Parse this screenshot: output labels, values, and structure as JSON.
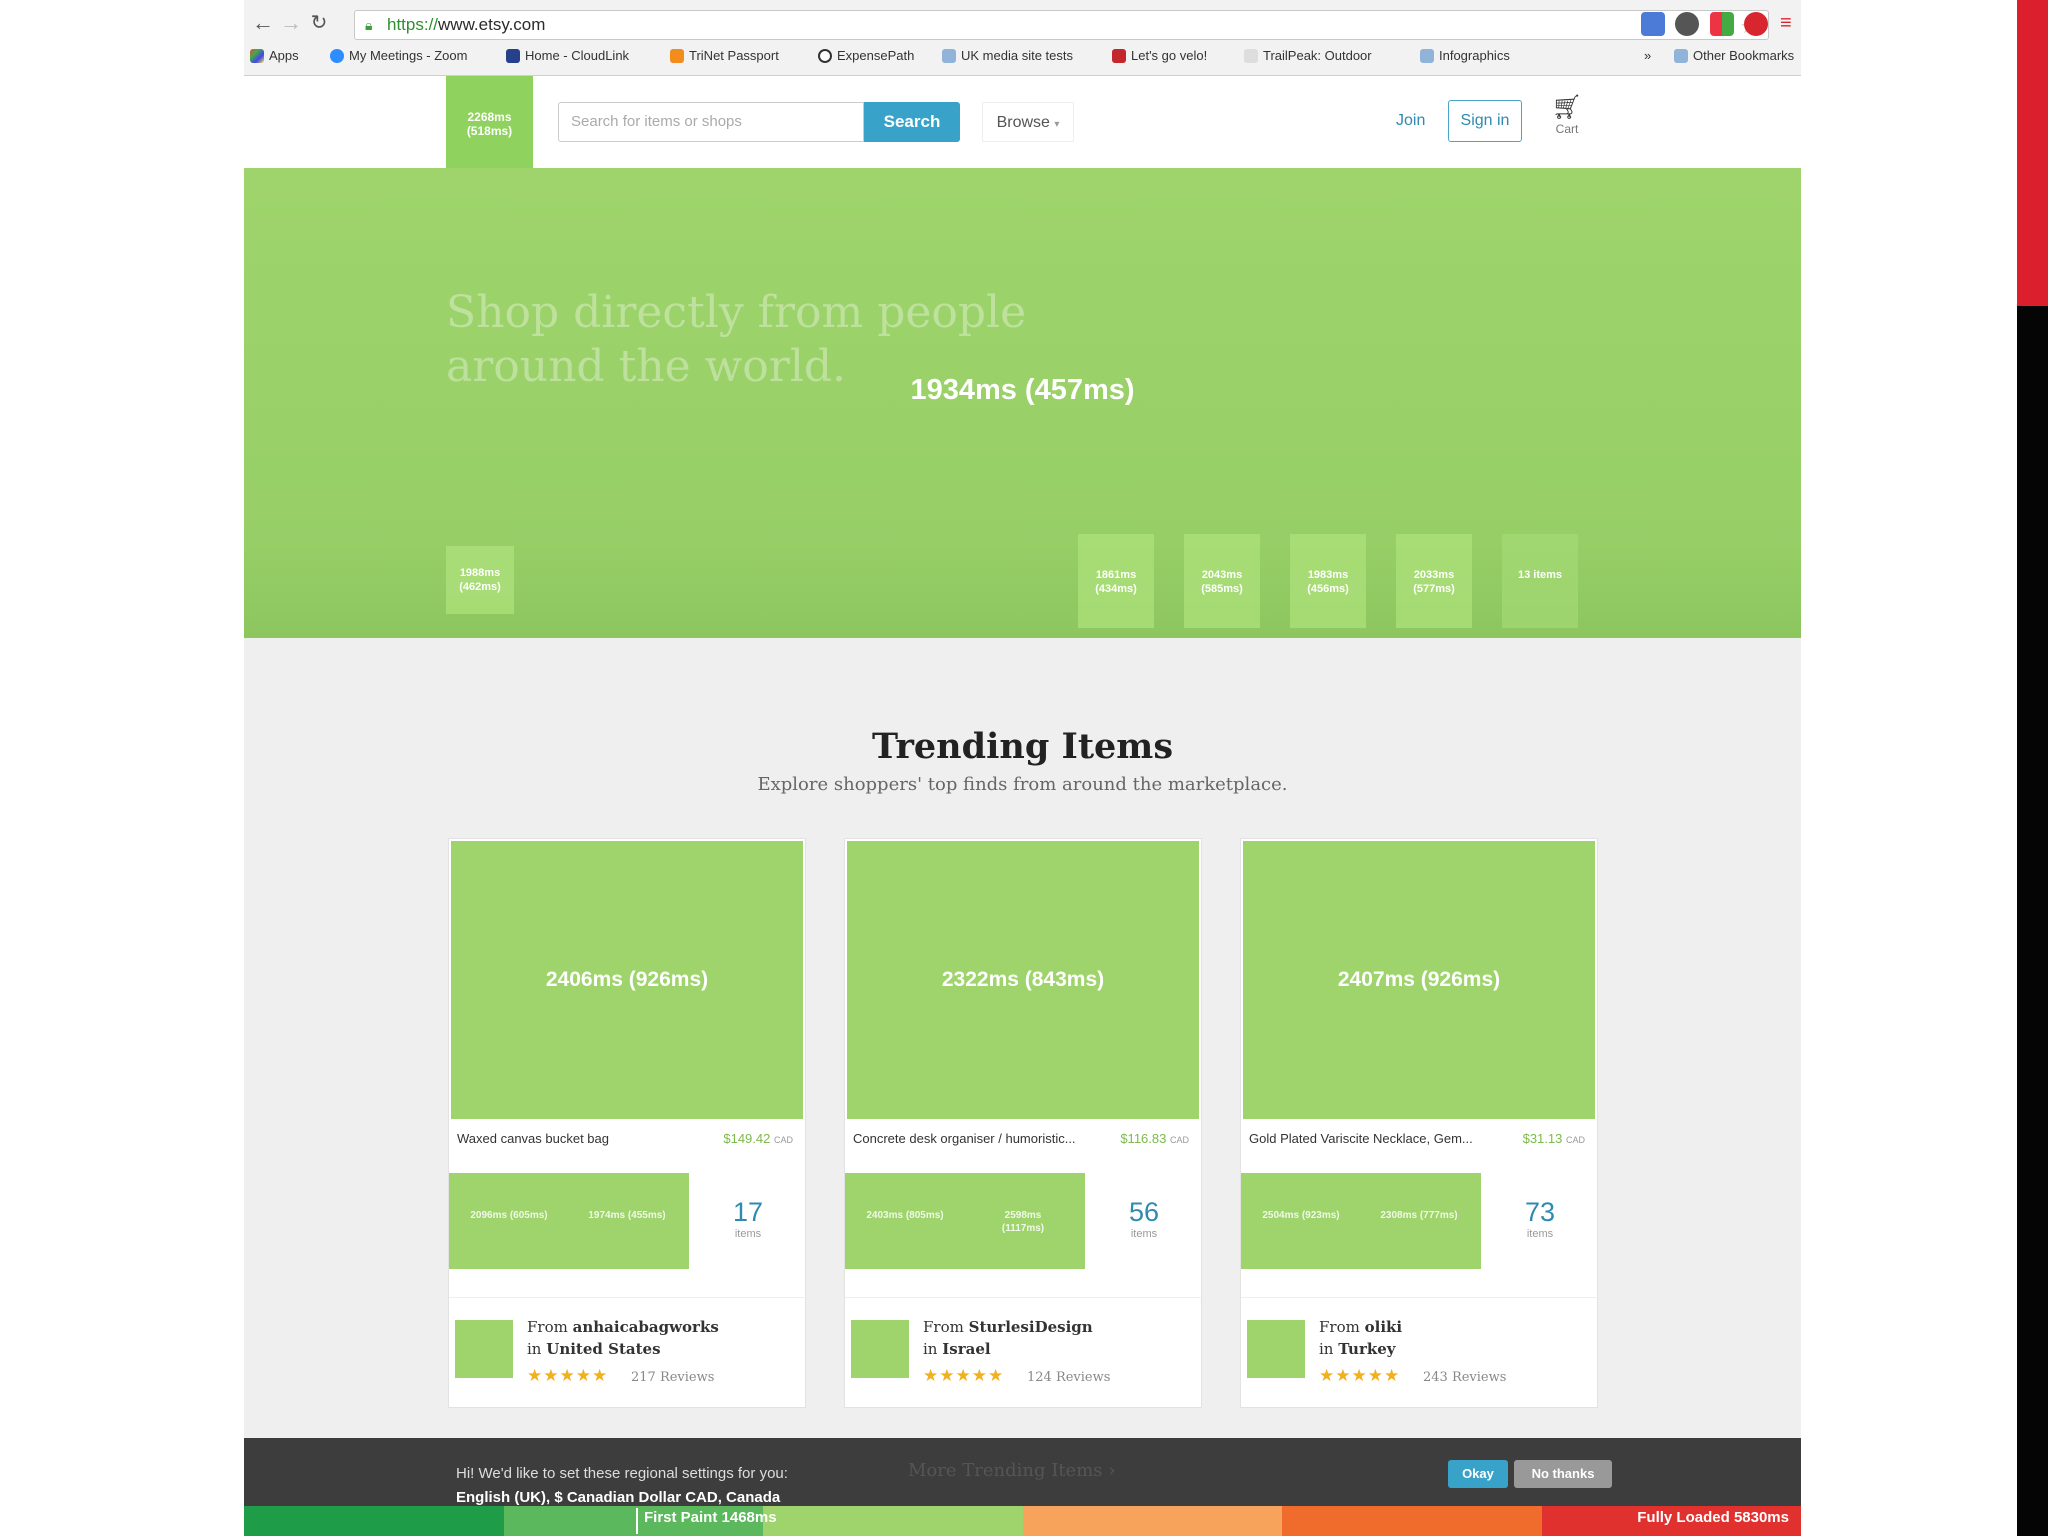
{
  "browser": {
    "url_scheme": "https://",
    "url_host": "www.etsy.com",
    "bookmarks": [
      "Apps",
      "My Meetings - Zoom",
      "Home - CloudLink",
      "TriNet Passport",
      "ExpensePath",
      "UK media site tests",
      "Let's go velo!",
      "TrailPeak: Outdoor",
      "Infographics"
    ],
    "other_bookmarks": "Other Bookmarks",
    "overflow": "»"
  },
  "header": {
    "logo_timing": "2268ms (518ms)",
    "search_placeholder": "Search for items or shops",
    "search_button": "Search",
    "browse": "Browse",
    "join": "Join",
    "sign_in": "Sign in",
    "cart": "Cart"
  },
  "hero": {
    "title": "Shop directly from people around the world.",
    "timing": "1934ms (457ms)",
    "left_tile": "1988ms (462ms)",
    "tiles": [
      "1861ms (434ms)",
      "2043ms (585ms)",
      "1983ms (456ms)",
      "2033ms (577ms)",
      "13 items"
    ]
  },
  "trending": {
    "title": "Trending Items",
    "subtitle": "Explore shoppers' top finds from around the marketplace.",
    "cards": [
      {
        "timing": "2406ms (926ms)",
        "title": "Waxed canvas bucket bag",
        "price": "$149.42",
        "currency": "CAD",
        "thumb1": "2096ms (605ms)",
        "thumb2": "1974ms (455ms)",
        "count": "17",
        "count_unit": "items",
        "from": "From",
        "shop": "anhaicabagworks",
        "in": "in",
        "country": "United States",
        "reviews": "217 Reviews",
        "stars": "★★★★★"
      },
      {
        "timing": "2322ms (843ms)",
        "title": "Concrete desk organiser / humoristic...",
        "price": "$116.83",
        "currency": "CAD",
        "thumb1": "2403ms (805ms)",
        "thumb2": "2598ms (1117ms)",
        "count": "56",
        "count_unit": "items",
        "from": "From",
        "shop": "SturlesiDesign",
        "in": "in",
        "country": "Israel",
        "reviews": "124 Reviews",
        "stars": "★★★★★"
      },
      {
        "timing": "2407ms (926ms)",
        "title": "Gold Plated Variscite Necklace, Gem...",
        "price": "$31.13",
        "currency": "CAD",
        "thumb1": "2504ms (923ms)",
        "thumb2": "2308ms (777ms)",
        "count": "73",
        "count_unit": "items",
        "from": "From",
        "shop": "oliki",
        "in": "in",
        "country": "Turkey",
        "reviews": "243 Reviews",
        "stars": "★★★★★"
      }
    ]
  },
  "banner": {
    "line1": "Hi! We'd like to set these regional settings for you:",
    "line2": "English (UK), $ Canadian Dollar CAD, Canada",
    "more": "More Trending Items ›",
    "okay": "Okay",
    "no_thanks": "No thanks"
  },
  "timeline": {
    "first_paint": "First Paint 1468ms",
    "fully_loaded": "Fully Loaded 5830ms",
    "colors": [
      "#1f9c47",
      "#5cb85c",
      "#9ed46b",
      "#f7a35c",
      "#ef6c2d",
      "#e0312f"
    ]
  }
}
